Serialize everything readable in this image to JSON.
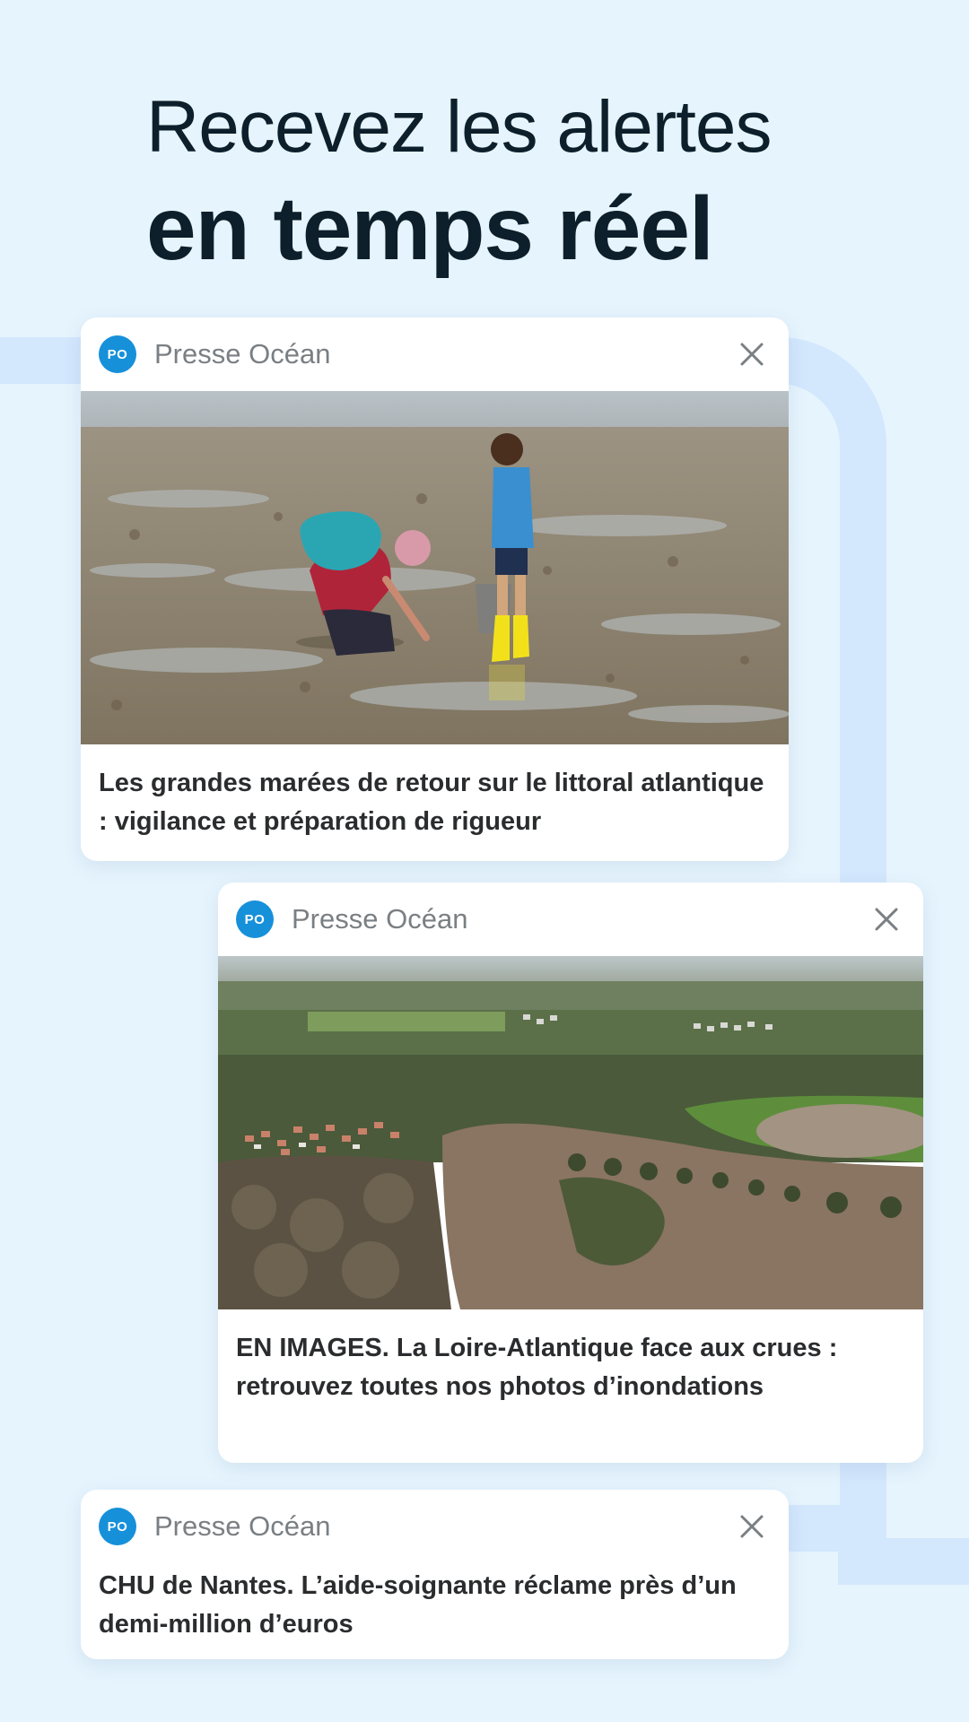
{
  "headline": {
    "line1": "Recevez les alertes",
    "line2": "en temps réel"
  },
  "notifications": [
    {
      "logo_text": "PO",
      "source": "Presse Océan",
      "close_icon": "close-icon",
      "image": "Adult and child collecting shellfish on tidal flats at low tide",
      "text": "Les grandes marées de retour sur le littoral atlantique : vigilance et préparation de rigueur"
    },
    {
      "logo_text": "PO",
      "source": "Presse Océan",
      "close_icon": "close-icon",
      "image": "Aerial view of flooded countryside and village",
      "text": "EN IMAGES. La Loire-Atlantique face aux crues : retrouvez toutes nos photos d’inondations"
    },
    {
      "logo_text": "PO",
      "source": "Presse Océan",
      "close_icon": "close-icon",
      "text": "CHU de Nantes. L’aide-soignante réclame près d’un demi-million d’euros"
    }
  ],
  "colors": {
    "background": "#e6f4fd",
    "track": "#d3e7fd",
    "brand_blue": "#1790da",
    "headline": "#0d1f2a"
  }
}
